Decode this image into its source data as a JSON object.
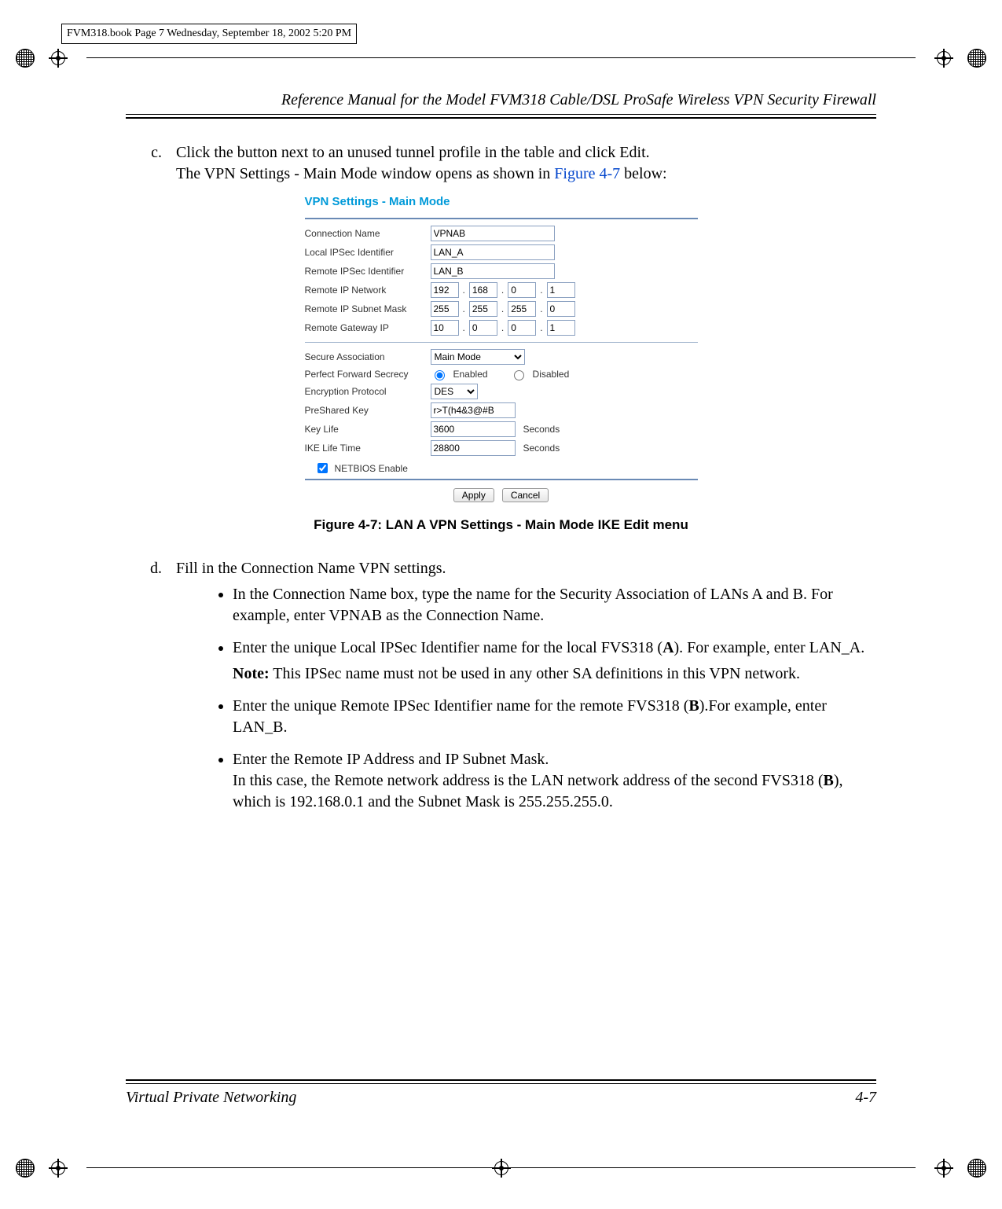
{
  "print_meta": "FVM318.book  Page 7  Wednesday, September 18, 2002  5:20 PM",
  "running_head": "Reference Manual for the Model FVM318 Cable/DSL ProSafe Wireless VPN Security Firewall",
  "step_c": {
    "label": "c.",
    "line1": "Click the button next to an unused tunnel profile in the table and click Edit.",
    "line2_a": "The VPN Settings - Main Mode window opens as shown in ",
    "line2_xref": "Figure 4-7",
    "line2_b": " below:"
  },
  "figure": {
    "title": "VPN Settings - Main Mode",
    "labels": {
      "connection_name": "Connection Name",
      "local_ipsec": "Local IPSec Identifier",
      "remote_ipsec": "Remote IPSec Identifier",
      "remote_ip_network": "Remote IP Network",
      "remote_ip_subnet": "Remote IP Subnet Mask",
      "remote_gateway": "Remote Gateway IP",
      "secure_assoc": "Secure Association",
      "pfs": "Perfect Forward Secrecy",
      "enc_proto": "Encryption Protocol",
      "psk": "PreShared Key",
      "key_life": "Key Life",
      "ike_life": "IKE Life Time",
      "netbios": "NETBIOS Enable"
    },
    "values": {
      "connection_name": "VPNAB",
      "local_ipsec": "LAN_A",
      "remote_ipsec": "LAN_B",
      "remote_ip_network": [
        "192",
        "168",
        "0",
        "1"
      ],
      "remote_ip_subnet": [
        "255",
        "255",
        "255",
        "0"
      ],
      "remote_gateway": [
        "10",
        "0",
        "0",
        "1"
      ],
      "secure_assoc": "Main Mode",
      "pfs_enabled_label": "Enabled",
      "pfs_disabled_label": "Disabled",
      "enc_proto": "DES",
      "psk": "r>T(h4&3@#B",
      "key_life": "3600",
      "key_life_unit": "Seconds",
      "ike_life": "28800",
      "ike_life_unit": "Seconds",
      "apply": "Apply",
      "cancel": "Cancel"
    },
    "caption": "Figure 4-7:  LAN A VPN Settings - Main Mode IKE Edit menu"
  },
  "step_d": {
    "label": "d.",
    "text": "Fill in the Connection Name VPN settings."
  },
  "bullets": {
    "b1": "In the Connection Name box, type the name for the Security Association of LANs A and B. For example, enter VPNAB as the Connection Name.",
    "b2_a": "Enter the unique Local IPSec Identifier name for the local FVS318 (",
    "b2_bold": "A",
    "b2_b": "). For example, enter LAN_A.",
    "note_label": "Note:",
    "note_text": " This IPSec name must not be used in any other SA definitions in this VPN network.",
    "b3_a": "Enter the unique Remote IPSec Identifier name for the remote FVS318 (",
    "b3_bold": "B",
    "b3_b": ").For example, enter LAN_B.",
    "b4_line1": "Enter the Remote IP Address and IP Subnet Mask.",
    "b4_line2_a": "In this case, the Remote network address is the LAN network address of the second FVS318 (",
    "b4_line2_bold": "B",
    "b4_line2_b": "), which is 192.168.0.1 and the Subnet Mask is 255.255.255.0."
  },
  "footer": {
    "left": "Virtual Private Networking",
    "right": "4-7"
  }
}
